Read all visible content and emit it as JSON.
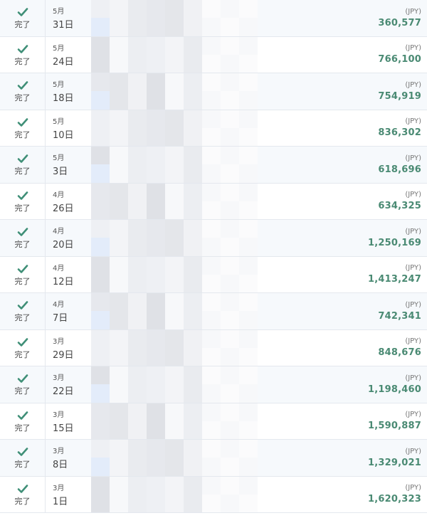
{
  "colors": {
    "check": "#3f8f77",
    "amount": "#4a8a73"
  },
  "icons": {
    "status": "checkmark-icon"
  },
  "rows": [
    {
      "status": "完了",
      "month": "5月",
      "day": "31日",
      "currency": "(JPY)",
      "amount": "360,577"
    },
    {
      "status": "完了",
      "month": "5月",
      "day": "24日",
      "currency": "(JPY)",
      "amount": "766,100"
    },
    {
      "status": "完了",
      "month": "5月",
      "day": "18日",
      "currency": "(JPY)",
      "amount": "754,919"
    },
    {
      "status": "完了",
      "month": "5月",
      "day": "10日",
      "currency": "(JPY)",
      "amount": "836,302"
    },
    {
      "status": "完了",
      "month": "5月",
      "day": "3日",
      "currency": "(JPY)",
      "amount": "618,696"
    },
    {
      "status": "完了",
      "month": "4月",
      "day": "26日",
      "currency": "(JPY)",
      "amount": "634,325"
    },
    {
      "status": "完了",
      "month": "4月",
      "day": "20日",
      "currency": "(JPY)",
      "amount": "1,250,169"
    },
    {
      "status": "完了",
      "month": "4月",
      "day": "12日",
      "currency": "(JPY)",
      "amount": "1,413,247"
    },
    {
      "status": "完了",
      "month": "4月",
      "day": "7日",
      "currency": "(JPY)",
      "amount": "742,341"
    },
    {
      "status": "完了",
      "month": "3月",
      "day": "29日",
      "currency": "(JPY)",
      "amount": "848,676"
    },
    {
      "status": "完了",
      "month": "3月",
      "day": "22日",
      "currency": "(JPY)",
      "amount": "1,198,460"
    },
    {
      "status": "完了",
      "month": "3月",
      "day": "15日",
      "currency": "(JPY)",
      "amount": "1,590,887"
    },
    {
      "status": "完了",
      "month": "3月",
      "day": "8日",
      "currency": "(JPY)",
      "amount": "1,329,021"
    },
    {
      "status": "完了",
      "month": "3月",
      "day": "1日",
      "currency": "(JPY)",
      "amount": "1,620,323"
    }
  ]
}
